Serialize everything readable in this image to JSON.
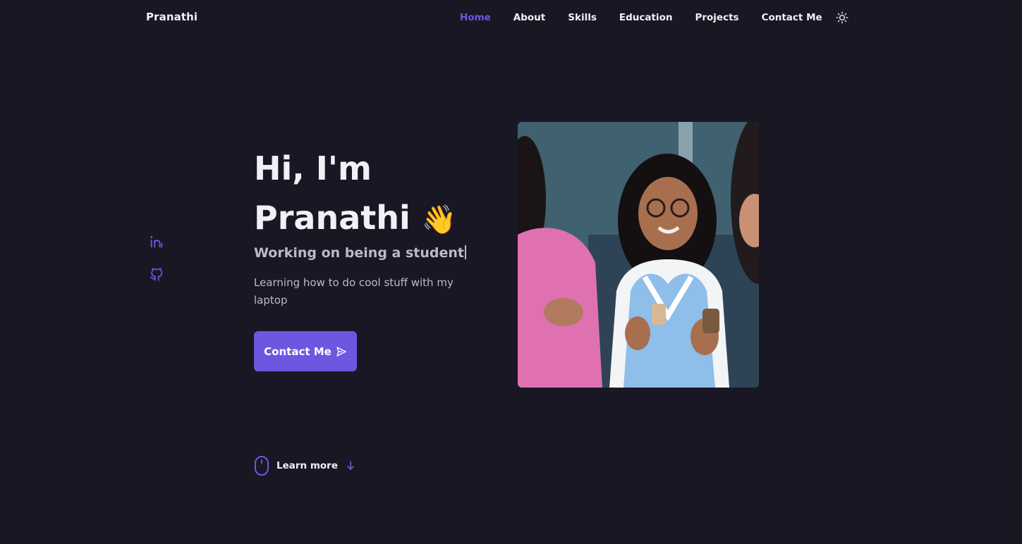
{
  "header": {
    "logo": "Pranathi",
    "nav": [
      {
        "label": "Home",
        "active": true
      },
      {
        "label": "About"
      },
      {
        "label": "Skills"
      },
      {
        "label": "Education"
      },
      {
        "label": "Projects"
      },
      {
        "label": "Contact Me"
      }
    ],
    "theme_icon": "sun-icon"
  },
  "social": [
    {
      "name": "linkedin-icon"
    },
    {
      "name": "github-icon"
    }
  ],
  "hero": {
    "greeting": "Hi, I'm",
    "name": "Pranathi",
    "wave_emoji": "👋",
    "subtitle": "Working on being a student",
    "description": "Learning how to do cool stuff with my laptop",
    "contact_label": "Contact Me"
  },
  "scroll": {
    "label": "Learn more"
  },
  "colors": {
    "background": "#1a1724",
    "accent": "#6e57e0",
    "text": "#f1f0f5",
    "muted": "#bdb9c8"
  }
}
